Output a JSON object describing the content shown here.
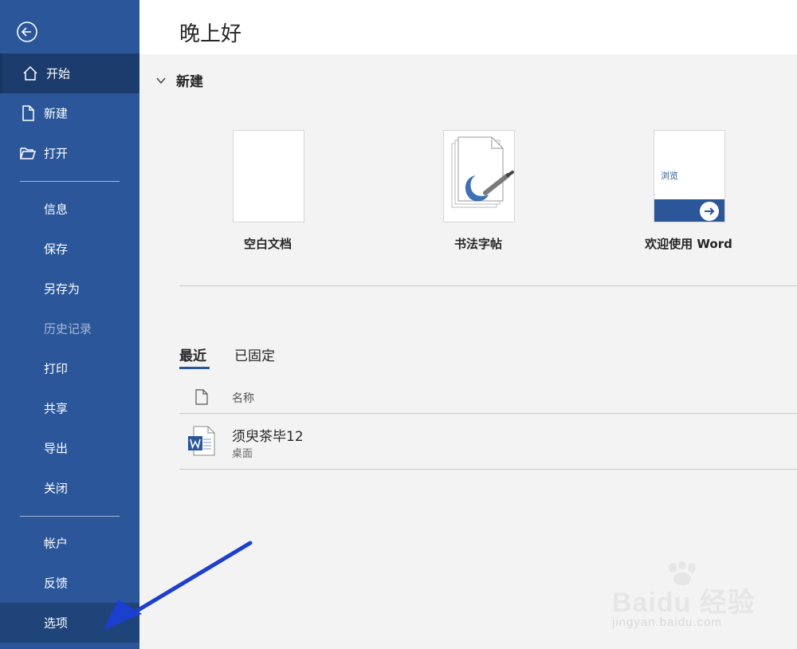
{
  "colors": {
    "sidebar": "#2b579a",
    "active_item": "#1b3c6d",
    "accent": "#2b579a",
    "annotation_arrow": "#1c3fcf"
  },
  "sidebar": {
    "items": [
      {
        "label": "开始",
        "icon": "home-icon"
      },
      {
        "label": "新建",
        "icon": "new-document-icon"
      },
      {
        "label": "打开",
        "icon": "folder-open-icon"
      },
      {
        "label": "信息"
      },
      {
        "label": "保存"
      },
      {
        "label": "另存为"
      },
      {
        "label": "历史记录"
      },
      {
        "label": "打印"
      },
      {
        "label": "共享"
      },
      {
        "label": "导出"
      },
      {
        "label": "关闭"
      },
      {
        "label": "帐户"
      },
      {
        "label": "反馈"
      },
      {
        "label": "选项"
      }
    ]
  },
  "main": {
    "greeting": "晚上好",
    "new_section": {
      "title": "新建",
      "templates": [
        {
          "name": "空白文档"
        },
        {
          "name": "书法字帖"
        },
        {
          "name": "欢迎使用 Word",
          "thumb_text": "浏览"
        }
      ]
    },
    "tabs": [
      {
        "label": "最近"
      },
      {
        "label": "已固定"
      }
    ],
    "list": {
      "column_name": "名称",
      "files": [
        {
          "name": "须臾茶毕12",
          "location": "桌面"
        }
      ]
    }
  },
  "watermark": {
    "brand": "Baidu 经验",
    "url": "jingyan.baidu.com"
  }
}
